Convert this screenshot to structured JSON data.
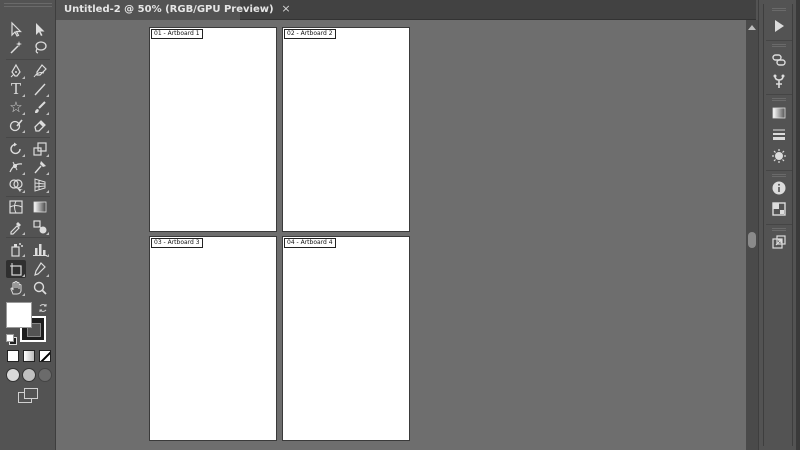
{
  "document_tab": {
    "title": "Untitled-2 @ 50% (RGB/GPU Preview)",
    "close_glyph": "×"
  },
  "tools": [
    {
      "name": "selection-tool-icon"
    },
    {
      "name": "direct-selection-tool-icon"
    },
    {
      "name": "magic-wand-tool-icon"
    },
    {
      "name": "lasso-tool-icon"
    },
    {
      "name": "pen-tool-icon"
    },
    {
      "name": "curvature-tool-icon"
    },
    {
      "name": "type-tool-icon",
      "glyph": "T"
    },
    {
      "name": "line-segment-tool-icon"
    },
    {
      "name": "star-tool-icon",
      "glyph": "☆"
    },
    {
      "name": "paintbrush-tool-icon"
    },
    {
      "name": "shaper-tool-icon"
    },
    {
      "name": "eraser-tool-icon"
    },
    {
      "name": "rotate-tool-icon"
    },
    {
      "name": "scale-tool-icon"
    },
    {
      "name": "width-tool-icon"
    },
    {
      "name": "puppet-warp-tool-icon"
    },
    {
      "name": "shape-builder-tool-icon"
    },
    {
      "name": "perspective-grid-tool-icon"
    },
    {
      "name": "mesh-tool-icon"
    },
    {
      "name": "gradient-tool-icon"
    },
    {
      "name": "eyedropper-tool-icon"
    },
    {
      "name": "blend-tool-icon"
    },
    {
      "name": "symbol-sprayer-tool-icon"
    },
    {
      "name": "column-graph-tool-icon"
    },
    {
      "name": "artboard-tool-icon",
      "active": true
    },
    {
      "name": "slice-tool-icon"
    },
    {
      "name": "hand-tool-icon"
    },
    {
      "name": "zoom-tool-icon"
    }
  ],
  "colors": {
    "fill": "#ffffff",
    "stroke": "#1e1e1e",
    "canvas": "#6e6e6e",
    "ui": "#535353"
  },
  "artboards": [
    {
      "label": "01 - Artboard 1"
    },
    {
      "label": "02 - Artboard 2"
    },
    {
      "label": "03 - Artboard 3"
    },
    {
      "label": "04 - Artboard 4"
    }
  ],
  "dock_icons": [
    "play-icon",
    "links-icon",
    "libraries-icon",
    "gradient-panel-icon",
    "stroke-panel-icon",
    "appearance-icon",
    "info-icon",
    "transform-icon",
    "export-icon"
  ]
}
